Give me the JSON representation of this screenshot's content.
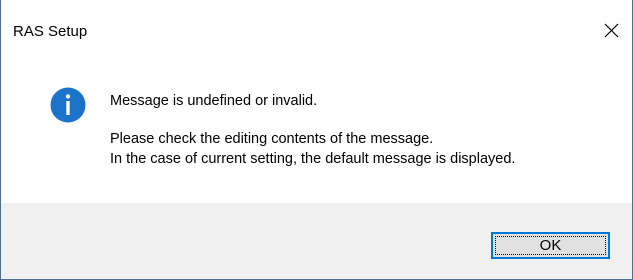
{
  "window": {
    "title": "RAS Setup",
    "close_icon": "close-x-icon"
  },
  "message": {
    "icon": "info-icon",
    "line1": "Message is undefined or invalid.",
    "line2": "Please check the editing contents of the message.",
    "line3": "In the case of current setting, the default message is displayed."
  },
  "buttons": {
    "ok_label": "OK"
  },
  "colors": {
    "info_icon": "#1a73c8",
    "button_focus_border": "#0078d7",
    "footer_background": "#f0f0f0"
  }
}
